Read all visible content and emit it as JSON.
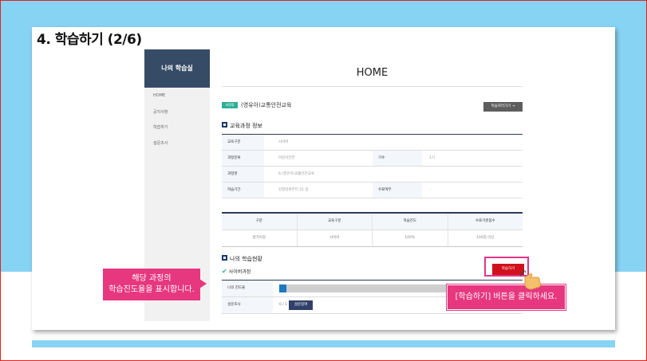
{
  "slide": {
    "title": "4. 학습하기 (2/6)"
  },
  "sidebar": {
    "title": "나의 학습실",
    "items": [
      {
        "label": "HOME"
      },
      {
        "label": "공지사항"
      },
      {
        "label": "학습하기"
      },
      {
        "label": "설문조사"
      }
    ]
  },
  "main": {
    "title": "HOME",
    "course_badge": "과정명",
    "course_name": "(영유아)교통안전교육",
    "go_study_button": "학습하러가기 →",
    "info_section_title": "교육과정 정보",
    "info_rows": {
      "category_label": "교육구분",
      "category_value": "사이버",
      "field_label": "과정분류",
      "field_value": "어린이안전",
      "term_label": "기수",
      "term_value": "1기",
      "course_label": "과정명",
      "course_value": "6.(영유아)교통안전교육",
      "period_label": "학습기간",
      "period_value": "신청일로부터 21 일",
      "completion_label": "수료여부",
      "completion_value": "-"
    },
    "stats_table": {
      "headers": [
        "구분",
        "교육구분",
        "학습진도",
        "수료기준점수"
      ],
      "row": [
        "평가비중",
        "사이버",
        "100%",
        "100점 이상"
      ]
    },
    "my_status_title": "나의 학습현황",
    "cyber_label": "사이버과정",
    "study_button": "학습하기",
    "progress_label": "나의 진도율",
    "progress_fraction": 0.03,
    "survey_label": "설문조사",
    "survey_count": "0 / 1",
    "survey_button": "설문참여"
  },
  "annotations": {
    "left_line1": "해당 과정의",
    "left_line2": "학습진도율을 표시합니다.",
    "right": "[학습하기] 버튼을 클릭하세요."
  },
  "colors": {
    "accent_pink": "#e6377f",
    "study_red": "#d0101c",
    "sky": "#87d3f3",
    "nav_dark": "#364b65"
  }
}
